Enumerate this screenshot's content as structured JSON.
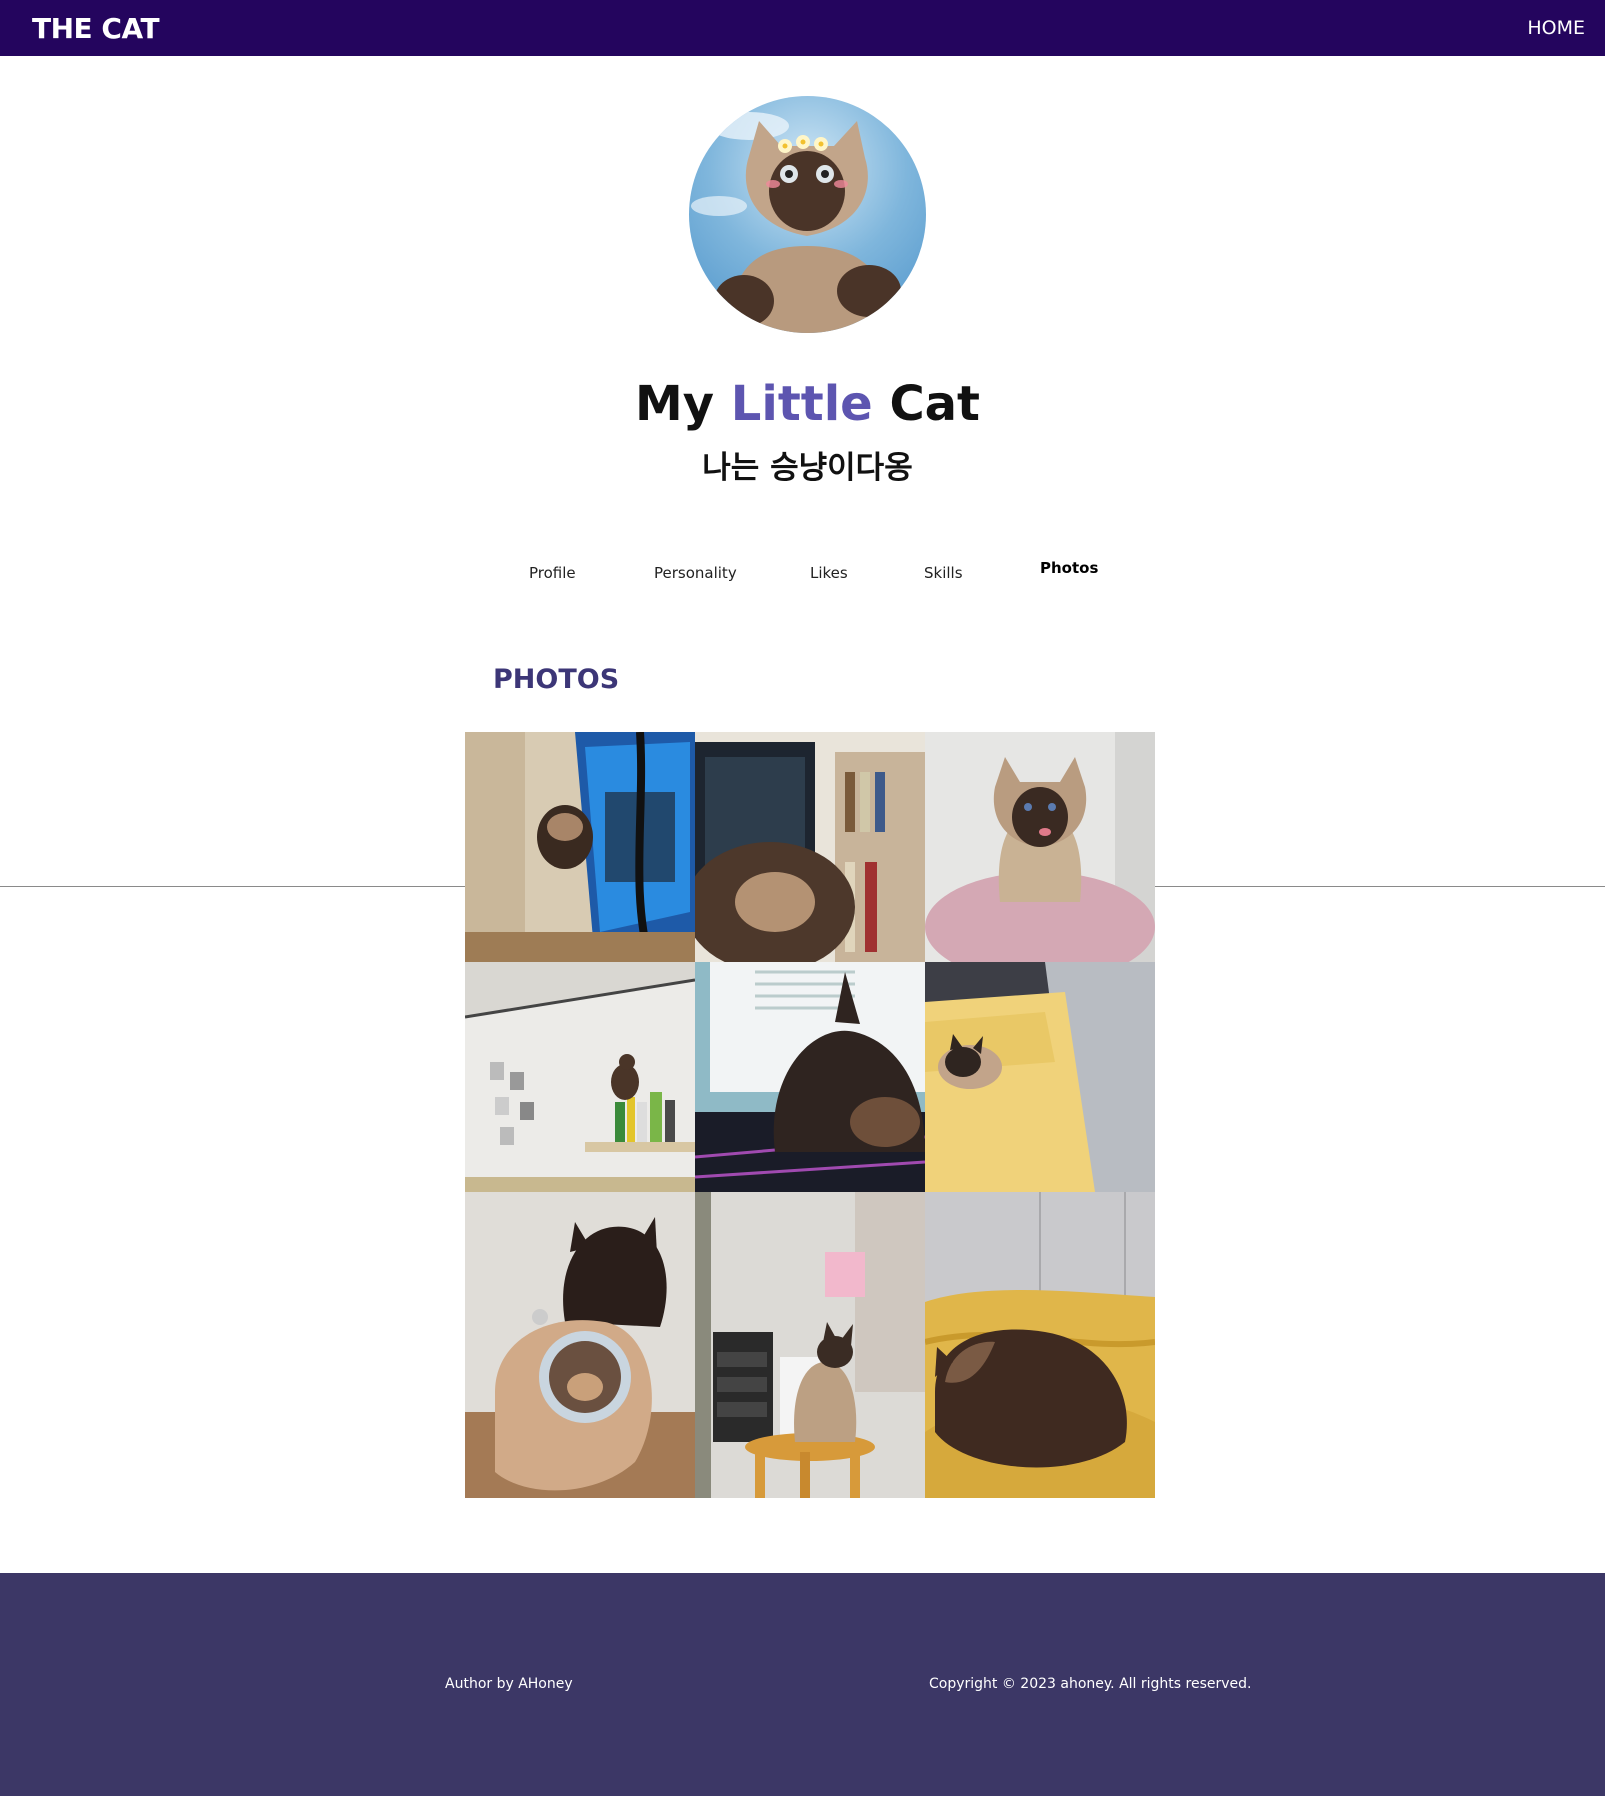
{
  "navbar": {
    "brand": "THE CAT",
    "home_link": "HOME"
  },
  "hero": {
    "title_part1": "My",
    "title_accent": "Little",
    "title_part2": "Cat",
    "subtitle": "나는 승냥이다옹"
  },
  "tabs": [
    {
      "label": "Profile"
    },
    {
      "label": "Personality"
    },
    {
      "label": "Likes"
    },
    {
      "label": "Skills"
    },
    {
      "label": "Photos"
    }
  ],
  "photos_section": {
    "heading": "PHOTOS",
    "photo_count": 9
  },
  "footer": {
    "author": "Author by AHoney",
    "copyright": "Copyright © 2023 ahoney. All rights reserved."
  },
  "colors": {
    "navbar": "#24055e",
    "accent": "#5d55b0",
    "heading": "#3c3677",
    "footer": "#3c3766"
  }
}
